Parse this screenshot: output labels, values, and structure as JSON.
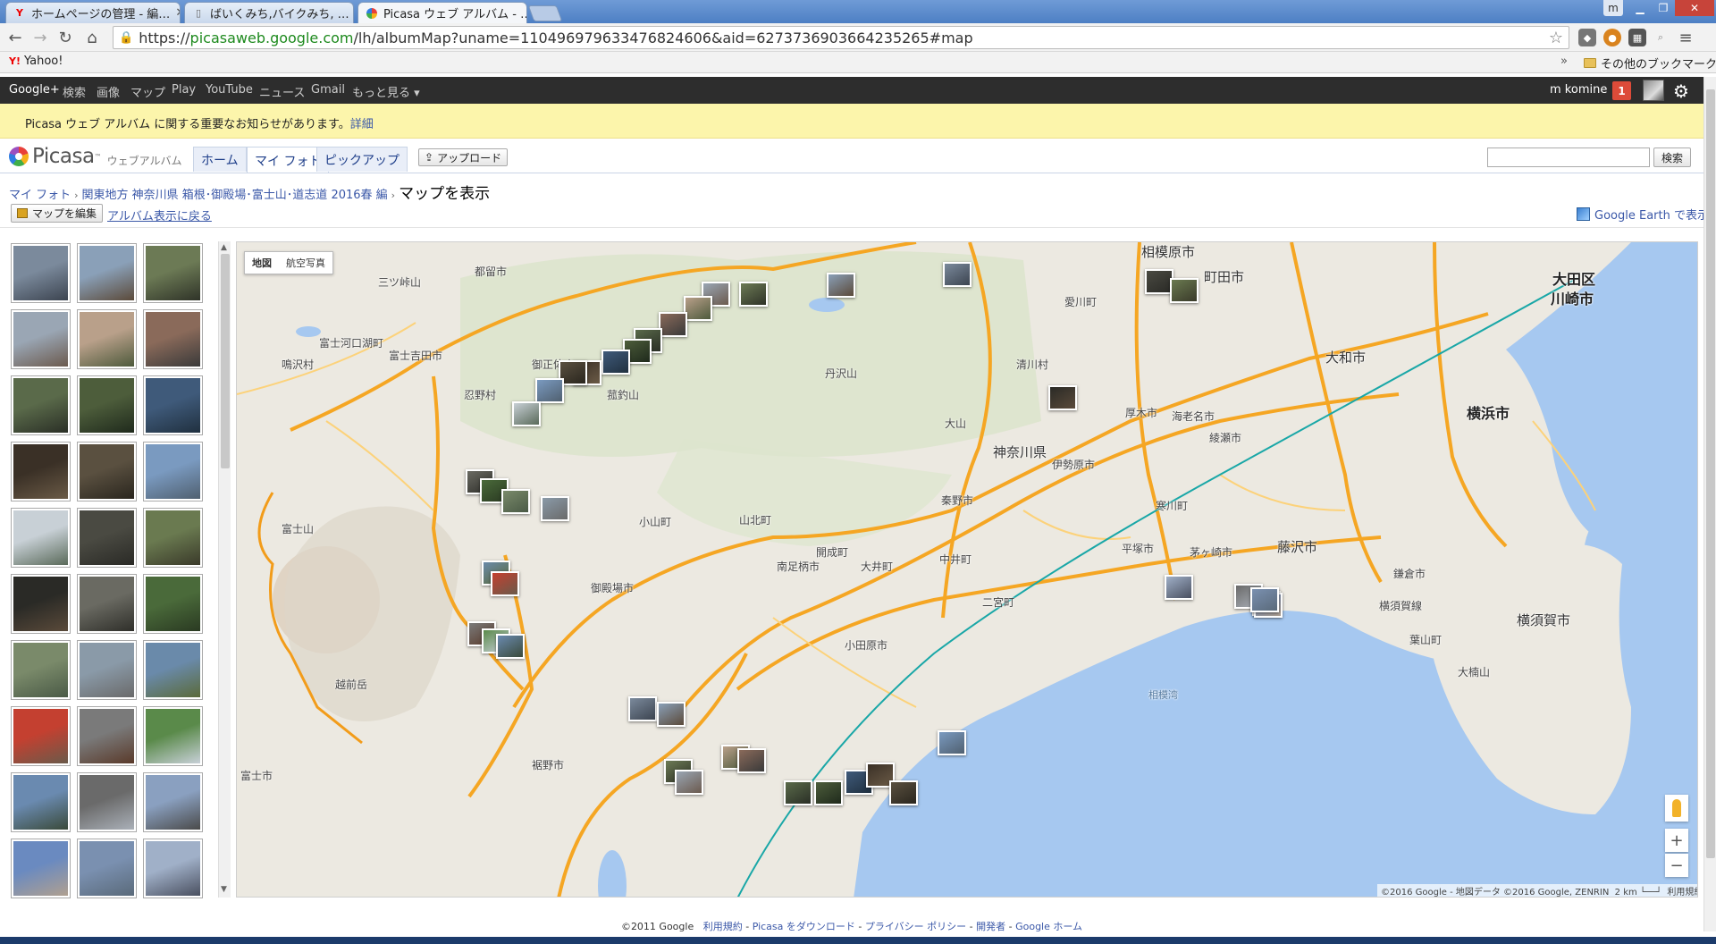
{
  "browser": {
    "tabs": [
      {
        "title": "ホームページの管理 - 編…",
        "icon": "yahoo-icon",
        "active": false
      },
      {
        "title": "ばいくみち,バイクみち, …",
        "icon": "document-icon",
        "active": false
      },
      {
        "title": "Picasa ウェブ アルバム - …",
        "icon": "picasa-icon",
        "active": true
      }
    ],
    "profile_label": "m",
    "url_scheme": "https://",
    "url_host": "picasaweb.google.com",
    "url_path": "/lh/albumMap?uname=110496979633476824606&aid=6273736903664235265#map",
    "bookmarks": [
      {
        "label": "Yahoo!"
      }
    ],
    "other_bookmarks": "その他のブックマーク",
    "overflow": "»"
  },
  "gbar": {
    "links": [
      "Google+",
      "検索",
      "画像",
      "マップ",
      "Play",
      "YouTube",
      "ニュース",
      "Gmail",
      "もっと見る ▾"
    ],
    "user": "m komine",
    "notifications": "1"
  },
  "notice": {
    "text": "Picasa ウェブ アルバム に関する重要なお知らせがあります。",
    "link": "詳細"
  },
  "picasa": {
    "brand": "Picasa",
    "brand_tm": "™",
    "brand_sub": "ウェブアルバム",
    "tabs": [
      {
        "label": "ホーム",
        "active": false
      },
      {
        "label": "マイ フォト",
        "active": true
      },
      {
        "label": "ピックアップ",
        "active": false
      }
    ],
    "upload": "アップロード",
    "search_button": "検索",
    "search_value": ""
  },
  "breadcrumb": {
    "root": "マイ フォト",
    "album": "関東地方 神奈川県 箱根･御殿場･富士山･道志道 2016春 編",
    "current": "マップを表示"
  },
  "actions": {
    "edit_map": "マップを編集",
    "back": "アルバム表示に戻る",
    "google_earth": "Google Earth で表示"
  },
  "map": {
    "type_buttons": [
      {
        "label": "地図",
        "active": true
      },
      {
        "label": "航空写真",
        "active": false
      }
    ],
    "labels": [
      {
        "text": "相模原市",
        "cls": "big"
      },
      {
        "text": "町田市",
        "cls": "big"
      },
      {
        "text": "大田区",
        "cls": "city"
      },
      {
        "text": "川崎市",
        "cls": "city"
      },
      {
        "text": "都留市",
        "cls": ""
      },
      {
        "text": "富士吉田市",
        "cls": ""
      },
      {
        "text": "富士河口湖町",
        "cls": ""
      },
      {
        "text": "忍野村",
        "cls": ""
      },
      {
        "text": "鳴沢村",
        "cls": ""
      },
      {
        "text": "三ツ峠山",
        "cls": ""
      },
      {
        "text": "御正体山",
        "cls": ""
      },
      {
        "text": "菰釣山",
        "cls": ""
      },
      {
        "text": "丹沢山",
        "cls": ""
      },
      {
        "text": "清川村",
        "cls": ""
      },
      {
        "text": "愛川町",
        "cls": ""
      },
      {
        "text": "大和市",
        "cls": "big"
      },
      {
        "text": "横浜市",
        "cls": "city"
      },
      {
        "text": "厚木市",
        "cls": ""
      },
      {
        "text": "海老名市",
        "cls": ""
      },
      {
        "text": "綾瀬市",
        "cls": ""
      },
      {
        "text": "大山",
        "cls": ""
      },
      {
        "text": "神奈川県",
        "cls": "big"
      },
      {
        "text": "伊勢原市",
        "cls": ""
      },
      {
        "text": "秦野市",
        "cls": ""
      },
      {
        "text": "寒川町",
        "cls": ""
      },
      {
        "text": "藤沢市",
        "cls": "big"
      },
      {
        "text": "茅ヶ崎市",
        "cls": ""
      },
      {
        "text": "平塚市",
        "cls": ""
      },
      {
        "text": "鎌倉市",
        "cls": ""
      },
      {
        "text": "富士山",
        "cls": ""
      },
      {
        "text": "小山町",
        "cls": ""
      },
      {
        "text": "山北町",
        "cls": ""
      },
      {
        "text": "開成町",
        "cls": ""
      },
      {
        "text": "南足柄市",
        "cls": ""
      },
      {
        "text": "大井町",
        "cls": ""
      },
      {
        "text": "中井町",
        "cls": ""
      },
      {
        "text": "二宮町",
        "cls": ""
      },
      {
        "text": "御殿場市",
        "cls": ""
      },
      {
        "text": "小田原市",
        "cls": ""
      },
      {
        "text": "横須賀市",
        "cls": "big"
      },
      {
        "text": "葉山町",
        "cls": ""
      },
      {
        "text": "大楠山",
        "cls": ""
      },
      {
        "text": "横須賀線",
        "cls": ""
      },
      {
        "text": "相模湾",
        "cls": "sea"
      },
      {
        "text": "裾野市",
        "cls": ""
      },
      {
        "text": "越前岳",
        "cls": ""
      },
      {
        "text": "富士市",
        "cls": ""
      }
    ],
    "attribution": "©2016 Google - 地図データ ©2016 Google, ZENRIN",
    "scale": "2 km",
    "terms": "利用規約"
  },
  "footer": {
    "copyright": "©2011 Google",
    "links": [
      "利用規約",
      "Picasa をダウンロード",
      "プライバシー ポリシー",
      "開発者",
      "Google ホーム"
    ]
  },
  "colors": {
    "gbar": "#2d2d2d",
    "notice": "#fcf5ab",
    "link": "#3b58a8",
    "sea": "#a6c8f0",
    "land": "#ece9e1",
    "road": "#f5a623"
  }
}
